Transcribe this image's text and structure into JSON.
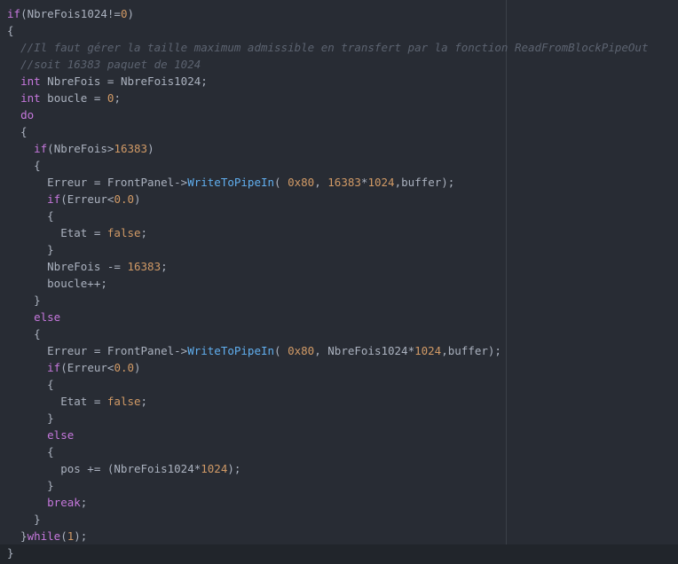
{
  "colors": {
    "background": "#282c34",
    "text": "#abb2bf",
    "keyword": "#c678dd",
    "number": "#d19a66",
    "function": "#61afef",
    "comment": "#5c6370"
  },
  "lines": [
    [
      {
        "t": "kw",
        "v": "if"
      },
      {
        "t": "tx",
        "v": "(NbreFois1024!="
      },
      {
        "t": "num",
        "v": "0"
      },
      {
        "t": "tx",
        "v": ")"
      }
    ],
    [
      {
        "t": "tx",
        "v": "{"
      }
    ],
    [
      {
        "t": "tx",
        "v": "  "
      },
      {
        "t": "cm",
        "v": "//Il faut gérer la taille maximum admissible en transfert par la fonction ReadFromBlockPipeOut"
      }
    ],
    [
      {
        "t": "tx",
        "v": "  "
      },
      {
        "t": "cm",
        "v": "//soit 16383 paquet de 1024"
      }
    ],
    [
      {
        "t": "tx",
        "v": "  "
      },
      {
        "t": "kw",
        "v": "int"
      },
      {
        "t": "tx",
        "v": " NbreFois = NbreFois1024;"
      }
    ],
    [
      {
        "t": "tx",
        "v": "  "
      },
      {
        "t": "kw",
        "v": "int"
      },
      {
        "t": "tx",
        "v": " boucle = "
      },
      {
        "t": "num",
        "v": "0"
      },
      {
        "t": "tx",
        "v": ";"
      }
    ],
    [
      {
        "t": "tx",
        "v": "  "
      },
      {
        "t": "kw",
        "v": "do"
      }
    ],
    [
      {
        "t": "tx",
        "v": "  {"
      }
    ],
    [
      {
        "t": "tx",
        "v": "    "
      },
      {
        "t": "kw",
        "v": "if"
      },
      {
        "t": "tx",
        "v": "(NbreFois>"
      },
      {
        "t": "num",
        "v": "16383"
      },
      {
        "t": "tx",
        "v": ")"
      }
    ],
    [
      {
        "t": "tx",
        "v": "    {"
      }
    ],
    [
      {
        "t": "tx",
        "v": "      Erreur = FrontPanel->"
      },
      {
        "t": "fn",
        "v": "WriteToPipeIn"
      },
      {
        "t": "tx",
        "v": "( "
      },
      {
        "t": "num",
        "v": "0x80"
      },
      {
        "t": "tx",
        "v": ", "
      },
      {
        "t": "num",
        "v": "16383"
      },
      {
        "t": "tx",
        "v": "*"
      },
      {
        "t": "num",
        "v": "1024"
      },
      {
        "t": "tx",
        "v": ",buffer);"
      }
    ],
    [
      {
        "t": "tx",
        "v": "      "
      },
      {
        "t": "kw",
        "v": "if"
      },
      {
        "t": "tx",
        "v": "(Erreur<"
      },
      {
        "t": "num",
        "v": "0.0"
      },
      {
        "t": "tx",
        "v": ")"
      }
    ],
    [
      {
        "t": "tx",
        "v": "      {"
      }
    ],
    [
      {
        "t": "tx",
        "v": "        Etat = "
      },
      {
        "t": "num",
        "v": "false"
      },
      {
        "t": "tx",
        "v": ";"
      }
    ],
    [
      {
        "t": "tx",
        "v": "      }"
      }
    ],
    [
      {
        "t": "tx",
        "v": "      NbreFois -= "
      },
      {
        "t": "num",
        "v": "16383"
      },
      {
        "t": "tx",
        "v": ";"
      }
    ],
    [
      {
        "t": "tx",
        "v": "      boucle++;"
      }
    ],
    [
      {
        "t": "tx",
        "v": "    }"
      }
    ],
    [
      {
        "t": "tx",
        "v": "    "
      },
      {
        "t": "kw",
        "v": "else"
      }
    ],
    [
      {
        "t": "tx",
        "v": "    {"
      }
    ],
    [
      {
        "t": "tx",
        "v": "      Erreur = FrontPanel->"
      },
      {
        "t": "fn",
        "v": "WriteToPipeIn"
      },
      {
        "t": "tx",
        "v": "( "
      },
      {
        "t": "num",
        "v": "0x80"
      },
      {
        "t": "tx",
        "v": ", NbreFois1024*"
      },
      {
        "t": "num",
        "v": "1024"
      },
      {
        "t": "tx",
        "v": ",buffer);"
      }
    ],
    [
      {
        "t": "tx",
        "v": "      "
      },
      {
        "t": "kw",
        "v": "if"
      },
      {
        "t": "tx",
        "v": "(Erreur<"
      },
      {
        "t": "num",
        "v": "0.0"
      },
      {
        "t": "tx",
        "v": ")"
      }
    ],
    [
      {
        "t": "tx",
        "v": "      {"
      }
    ],
    [
      {
        "t": "tx",
        "v": "        Etat = "
      },
      {
        "t": "num",
        "v": "false"
      },
      {
        "t": "tx",
        "v": ";"
      }
    ],
    [
      {
        "t": "tx",
        "v": "      }"
      }
    ],
    [
      {
        "t": "tx",
        "v": "      "
      },
      {
        "t": "kw",
        "v": "else"
      }
    ],
    [
      {
        "t": "tx",
        "v": "      {"
      }
    ],
    [
      {
        "t": "tx",
        "v": "        pos += (NbreFois1024*"
      },
      {
        "t": "num",
        "v": "1024"
      },
      {
        "t": "tx",
        "v": ");"
      }
    ],
    [
      {
        "t": "tx",
        "v": "      }"
      }
    ],
    [
      {
        "t": "tx",
        "v": "      "
      },
      {
        "t": "kw",
        "v": "break"
      },
      {
        "t": "tx",
        "v": ";"
      }
    ],
    [
      {
        "t": "tx",
        "v": "    }"
      }
    ],
    [
      {
        "t": "tx",
        "v": "  }"
      },
      {
        "t": "kw",
        "v": "while"
      },
      {
        "t": "tx",
        "v": "("
      },
      {
        "t": "num",
        "v": "1"
      },
      {
        "t": "tx",
        "v": ");"
      }
    ],
    [
      {
        "t": "tx",
        "v": "}"
      }
    ]
  ]
}
